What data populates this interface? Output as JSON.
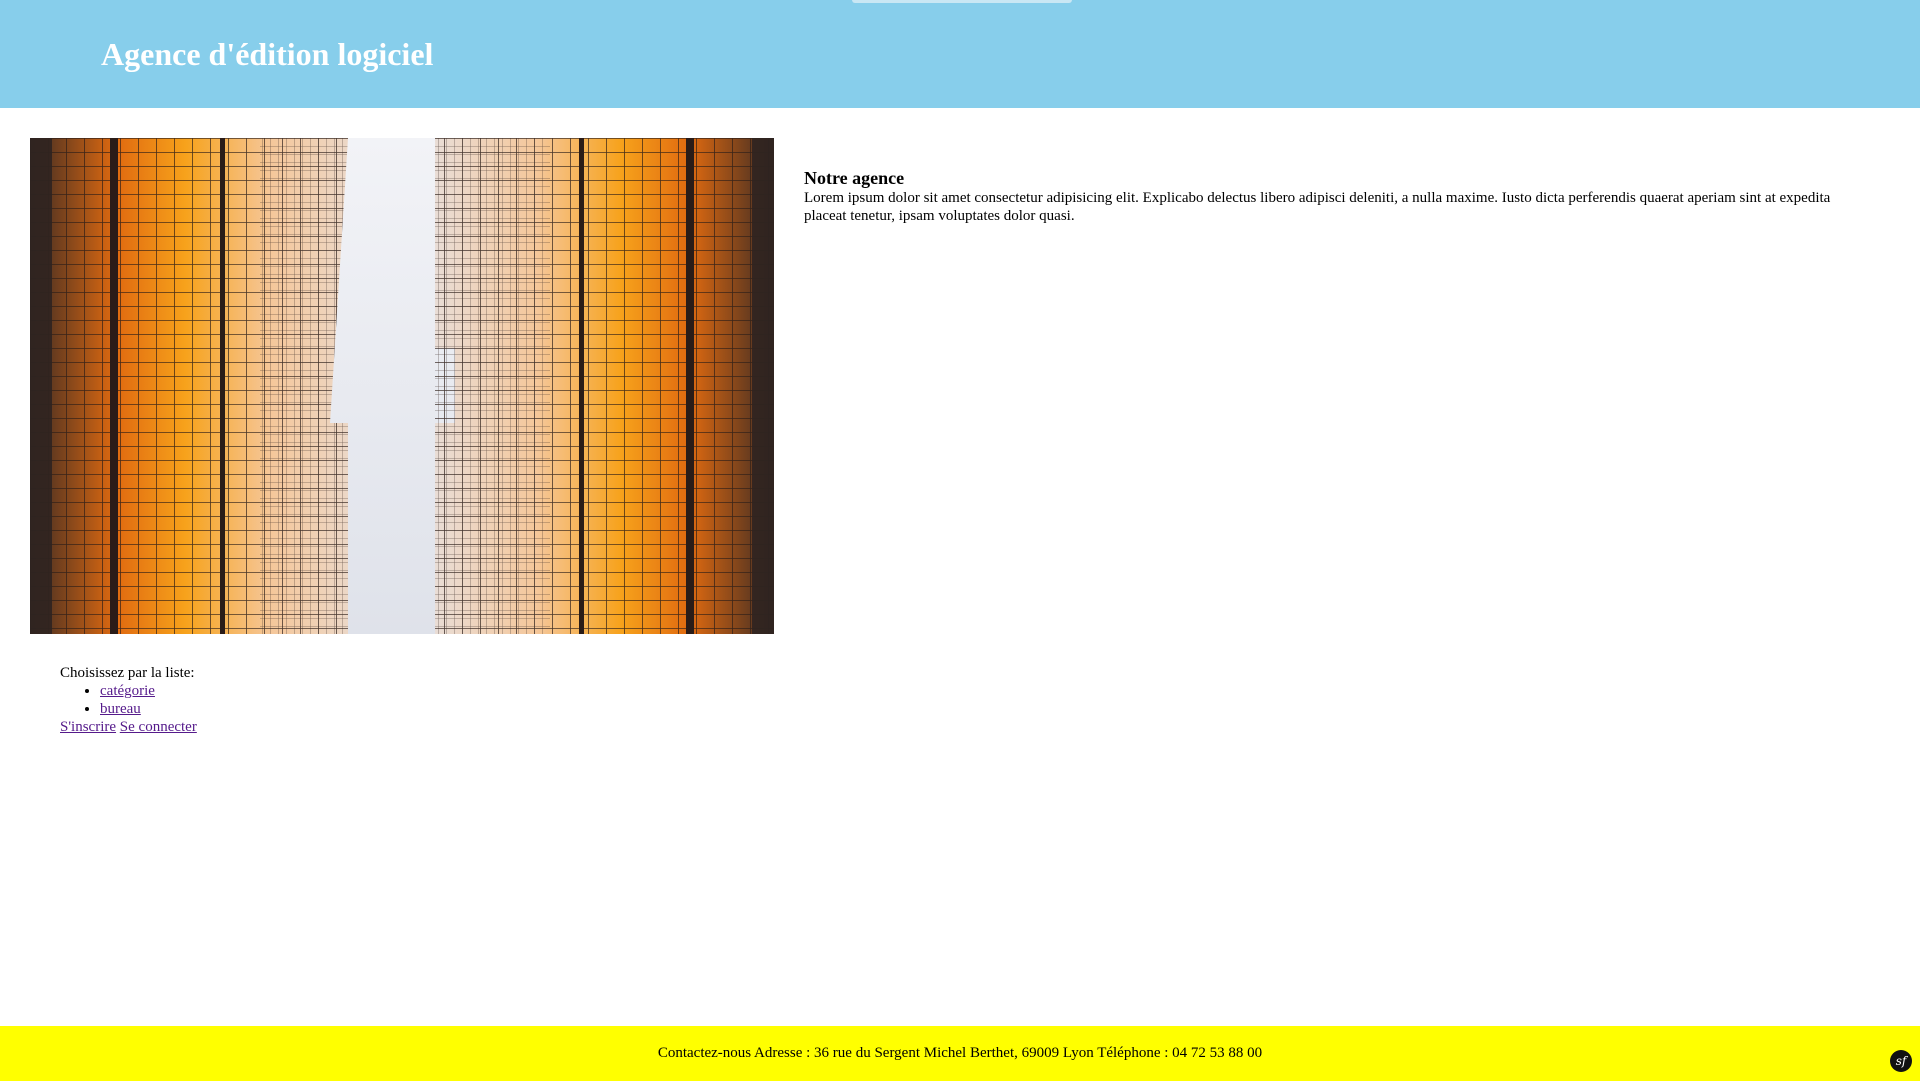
{
  "header": {
    "title": "Agence d'édition logiciel",
    "background": "#87ceeb"
  },
  "hero": {
    "image_description": "upward view between two glass skyscrapers with orange reflections"
  },
  "about": {
    "title": "Notre agence",
    "text": "Lorem ipsum dolor sit amet consectetur adipisicing elit. Explicabo delectus libero adipisci deleniti, a nulla maxime. Iusto dicta perferendis quaerat aperiam sint at expedita placeat tenetur, ipsam voluptates dolor quasi."
  },
  "nav": {
    "prompt": "Choisissez par la liste:",
    "items": [
      {
        "label": "catégorie"
      },
      {
        "label": "bureau"
      }
    ],
    "register_label": "S'inscrire",
    "login_label": "Se connecter",
    "link_color": "#551a8b"
  },
  "footer": {
    "text": "Contactez-nous Adresse : 36 rue du Sergent Michel Berthet, 69009 Lyon Téléphone : 04 72 53 88 00",
    "background": "#ffff00"
  },
  "toolbar_badge": {
    "icon": "symfony-icon",
    "glyph": "sf"
  }
}
